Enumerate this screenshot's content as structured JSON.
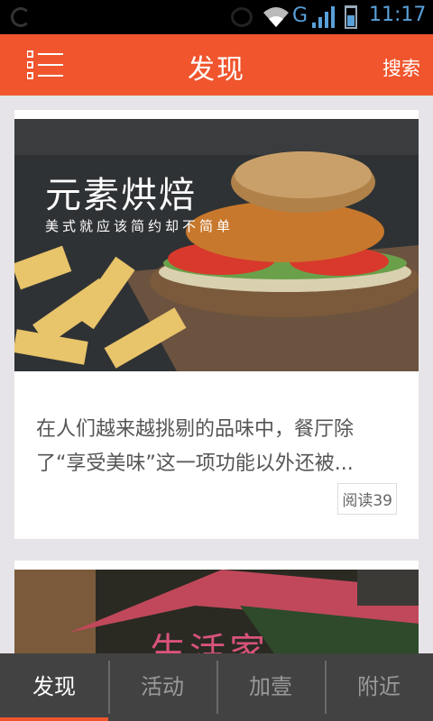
{
  "status_bar": {
    "time": "11:17",
    "network": "G",
    "icons": [
      "sync-icon",
      "alarm-icon",
      "wifi-icon",
      "signal-icon",
      "battery-icon"
    ]
  },
  "header": {
    "title": "发现",
    "search_label": "搜索",
    "menu_icon": "menu-list-icon",
    "background": "#f0552d"
  },
  "feed": [
    {
      "image_title": "元素烘焙",
      "image_subtitle": "美式就应该简约却不简单",
      "excerpt": "在人们越来越挑剔的品味中，餐厅除了“享受美味”这一项功能以外还被...",
      "read_count": "阅读39"
    },
    {
      "image_title": "生活家"
    }
  ],
  "tabs": [
    {
      "label": "发现",
      "active": true
    },
    {
      "label": "活动",
      "active": false
    },
    {
      "label": "加壹",
      "active": false
    },
    {
      "label": "附近",
      "active": false
    }
  ],
  "colors": {
    "accent": "#f0552d",
    "tabbar": "#424242",
    "background": "#e6e4e8"
  }
}
